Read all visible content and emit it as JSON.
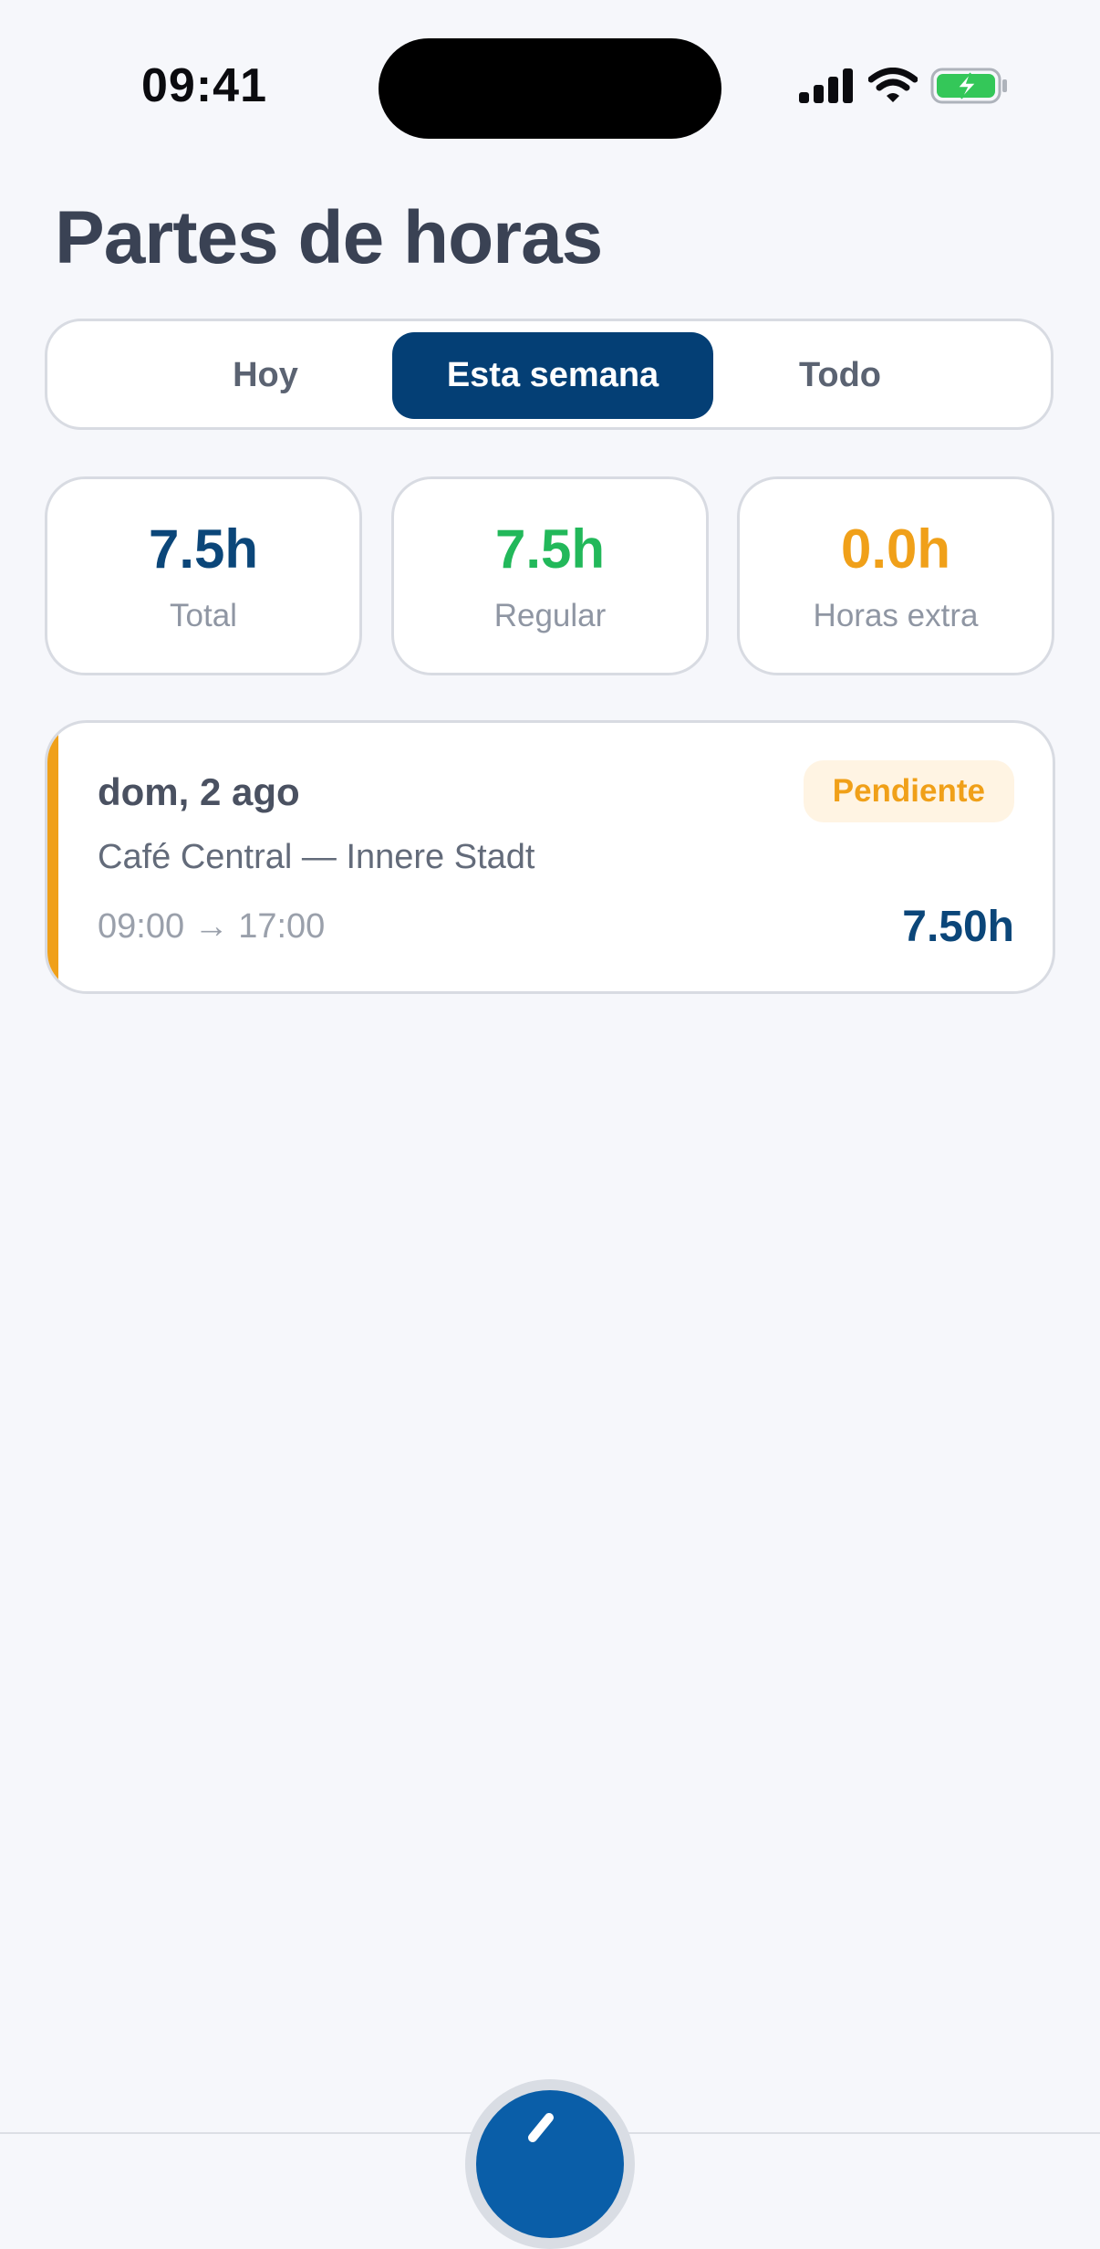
{
  "status_bar": {
    "time": "09:41",
    "icons": [
      "signal-icon",
      "wifi-icon",
      "battery-charging-icon"
    ]
  },
  "page": {
    "title": "Partes de horas"
  },
  "filter_tabs": [
    {
      "label": "Hoy",
      "active": false
    },
    {
      "label": "Esta semana",
      "active": true
    },
    {
      "label": "Todo",
      "active": false
    }
  ],
  "stats": [
    {
      "value": "7.5h",
      "label": "Total",
      "color": "#0b4679"
    },
    {
      "value": "7.5h",
      "label": "Regular",
      "color": "#22b85a"
    },
    {
      "value": "0.0h",
      "label": "Horas extra",
      "color": "#f0a019"
    }
  ],
  "entries": [
    {
      "date": "dom, 2 ago",
      "status": "Pendiente",
      "location": "Café Central — Innere Stadt",
      "time_range": "09:00 → 17:00",
      "hours": "7.50h",
      "accent_color": "#f0a019",
      "status_color": "#f0a019",
      "status_bg": "#fff4e3",
      "hours_color": "#0b4679"
    }
  ],
  "colors": {
    "primary": "#043f75",
    "background": "#f6f7fb",
    "fab": "#0a5ea8"
  }
}
